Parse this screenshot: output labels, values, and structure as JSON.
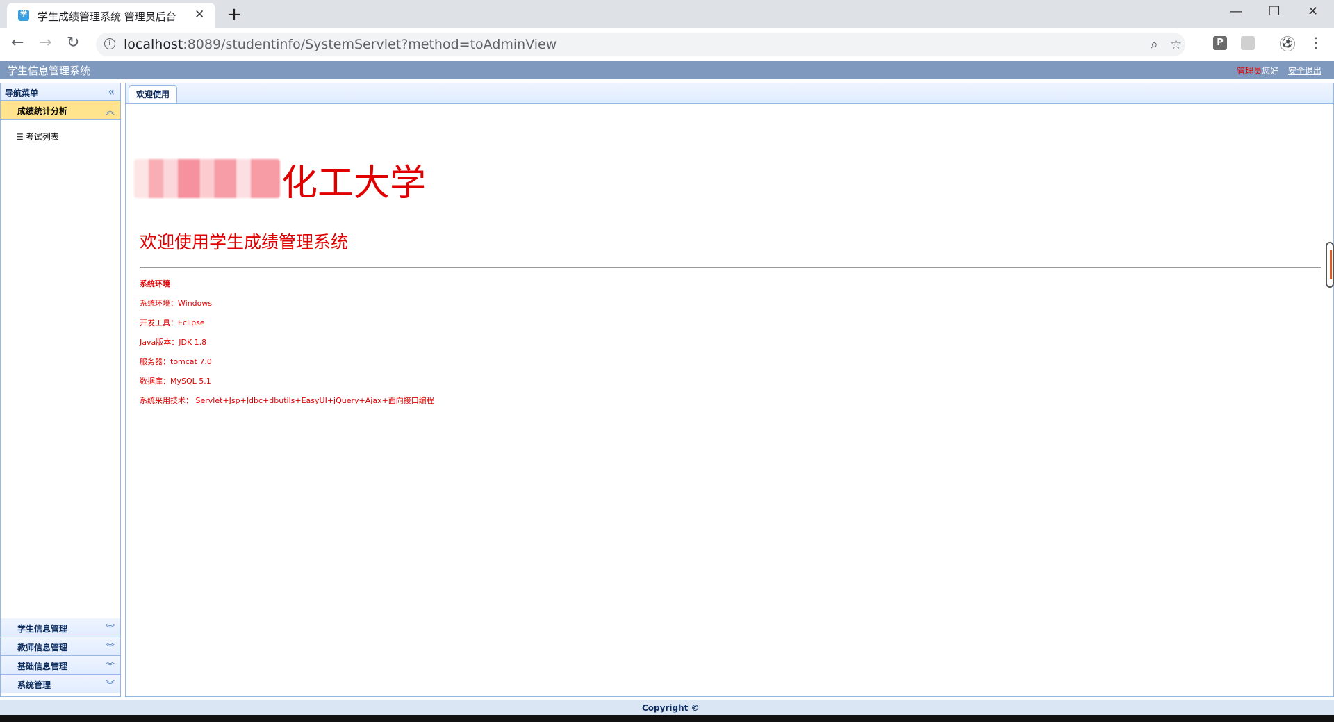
{
  "browser": {
    "tab_title": "学生成绩管理系统 管理员后台",
    "tab_favicon_text": "学",
    "url_host": "localhost",
    "url_rest": ":8089/studentinfo/SystemServlet?method=toAdminView",
    "ext_p_label": "P"
  },
  "header": {
    "app_title": "学生信息管理系统",
    "role": "管理员",
    "greeting": "您好",
    "logout": "安全退出"
  },
  "sidebar": {
    "title": "导航菜单",
    "open_section": {
      "label": "成绩统计分析",
      "items": [
        "考试列表"
      ]
    },
    "sections": [
      "学生信息管理",
      "教师信息管理",
      "基础信息管理",
      "系统管理"
    ]
  },
  "main": {
    "tab_label": "欢迎使用",
    "logo_suffix": "化工大学",
    "welcome": "欢迎使用学生成绩管理系统",
    "env_title": "系统环境",
    "env_lines": [
      "系统环境：Windows",
      "开发工具：Eclipse",
      "Java版本：JDK 1.8",
      "服务器：tomcat 7.0",
      "数据库：MySQL 5.1",
      "系统采用技术： Servlet+Jsp+Jdbc+dbutils+EasyUI+jQuery+Ajax+面向接口编程"
    ]
  },
  "footer": {
    "copyright": "Copyright ©"
  },
  "icons": {
    "back": "arrow-left-icon",
    "forward": "arrow-right-icon",
    "reload": "reload-icon",
    "zoom": "search-icon",
    "star": "star-icon",
    "menu": "kebab-menu-icon",
    "collapse": "double-chevron-left-icon",
    "expand": "double-chevron-down-icon",
    "list": "list-icon"
  }
}
